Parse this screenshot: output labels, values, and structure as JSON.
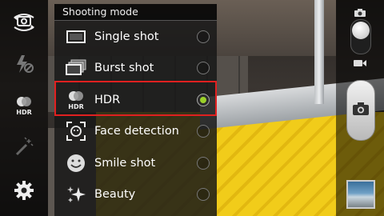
{
  "panel": {
    "title": "Shooting mode",
    "modes": [
      {
        "label": "Single shot",
        "icon": "single-shot-icon",
        "selected": false
      },
      {
        "label": "Burst shot",
        "icon": "burst-shot-icon",
        "selected": false
      },
      {
        "label": "HDR",
        "icon": "hdr-icon",
        "selected": true
      },
      {
        "label": "Face detection",
        "icon": "face-detection-icon",
        "selected": false
      },
      {
        "label": "Smile shot",
        "icon": "smile-shot-icon",
        "selected": false
      },
      {
        "label": "Beauty",
        "icon": "beauty-icon",
        "selected": false
      }
    ]
  },
  "left_bar": {
    "items": [
      {
        "icon": "switch-camera-icon"
      },
      {
        "icon": "flash-off-icon"
      },
      {
        "icon": "hdr-mode-icon",
        "label": "HDR"
      },
      {
        "icon": "effects-wand-icon"
      },
      {
        "icon": "settings-gear-icon"
      }
    ]
  },
  "right_bar": {
    "items": [
      {
        "icon": "camera-mode-icon"
      },
      {
        "icon": "mode-switch-toggle"
      },
      {
        "icon": "video-mode-icon"
      },
      {
        "icon": "shutter-camera-icon"
      },
      {
        "icon": "gallery-thumbnail"
      }
    ]
  },
  "colors": {
    "selection_highlight": "#e02020",
    "radio_selected": "#9bd12a"
  }
}
